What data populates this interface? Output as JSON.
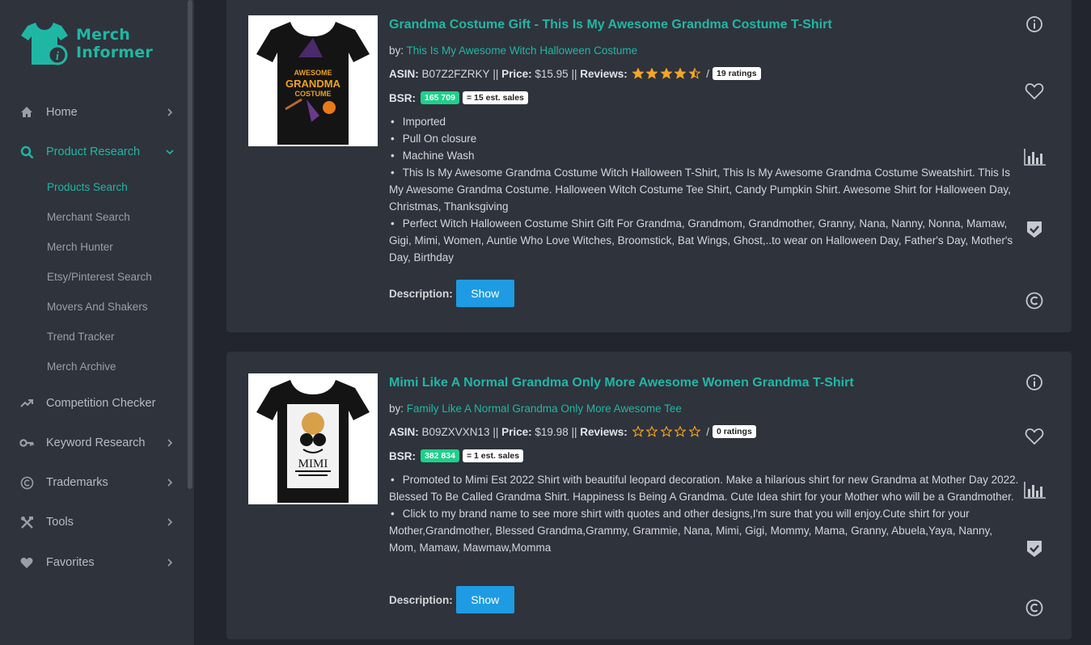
{
  "brand": {
    "line1": "Merch",
    "line2": "Informer",
    "color": "#1fb7a4"
  },
  "sidebar": {
    "items": [
      {
        "label": "Home",
        "icon": "home-icon"
      },
      {
        "label": "Product Research",
        "icon": "search-icon"
      },
      {
        "label": "Competition Checker",
        "icon": "trending-up-icon"
      },
      {
        "label": "Keyword Research",
        "icon": "key-icon"
      },
      {
        "label": "Trademarks",
        "icon": "copyright-icon"
      },
      {
        "label": "Tools",
        "icon": "tools-icon"
      },
      {
        "label": "Favorites",
        "icon": "heart-icon"
      }
    ],
    "subitems": [
      "Products Search",
      "Merchant Search",
      "Merch Hunter",
      "Etsy/Pinterest Search",
      "Movers And Shakers",
      "Trend Tracker",
      "Merch Archive"
    ]
  },
  "labels": {
    "by": "by:",
    "asin": "ASIN:",
    "price": "Price:",
    "reviews": "Reviews:",
    "bsr": "BSR:",
    "description": "Description:",
    "show": "Show",
    "sep": "||",
    "slash": "/"
  },
  "products": [
    {
      "title": "Grandma Costume Gift - This Is My Awesome Grandma Costume T-Shirt",
      "brand": "This Is My Awesome Witch Halloween Costume",
      "asin": "B07Z2FZRKY",
      "price": "$15.95",
      "rating": 4.5,
      "ratings_text": "19 ratings",
      "bsr": "165 709",
      "est_sales": "= 15 est. sales",
      "image_text": [
        "AWESOME",
        "GRANDMA",
        "COSTUME"
      ],
      "bullets": [
        "Imported",
        "Pull On closure",
        "Machine Wash",
        "This Is My Awesome Grandma Costume Witch Halloween T-Shirt, This Is My Awesome Grandma Costume Sweatshirt. This Is My Awesome Grandma Costume. Halloween Witch Costume Tee Shirt, Candy Pumpkin Shirt. Awesome Shirt for Halloween Day, Christmas, Thanksgiving",
        "Perfect Witch Halloween Costume Shirt Gift For Grandma, Grandmom, Grandmother, Granny, Nana, Nanny, Nonna, Mamaw, Gigi, Mimi, Women, Auntie Who Love Witches, Broomstick, Bat Wings, Ghost,..to wear on Halloween Day, Father's Day, Mother's Day, Birthday"
      ]
    },
    {
      "title": "Mimi Like A Normal Grandma Only More Awesome Women Grandma T-Shirt",
      "brand": "Family Like A Normal Grandma Only More Awesome Tee",
      "asin": "B09ZXVXN13",
      "price": "$19.98",
      "rating": 0,
      "ratings_text": "0 ratings",
      "bsr": "382 834",
      "est_sales": "= 1 est. sales",
      "image_text": [
        "MIMI"
      ],
      "bullets": [
        "Promoted to Mimi Est 2022 Shirt with beautiful leopard decoration. Make a hilarious shirt for new Grandma at Mother Day 2022. Blessed To Be Called Grandma Shirt. Happiness Is Being A Grandma. Cute Idea shirt for your Mother who will be a Grandmother.",
        "Click to my brand name to see more shirt with quotes and other designs,I'm sure that you will enjoy.Cute shirt for your Mother,Grandmother, Blessed Grandma,Grammy, Grammie, Nana, Mimi, Gigi, Mommy, Mama, Granny, Abuela,Yaya, Nanny, Mom, Mamaw, Mawmaw,Momma"
      ]
    }
  ],
  "colors": {
    "accent": "#1fb7a4",
    "button": "#1e9be3",
    "bsr_pill": "#1fd08a",
    "star": "#f5a623"
  }
}
